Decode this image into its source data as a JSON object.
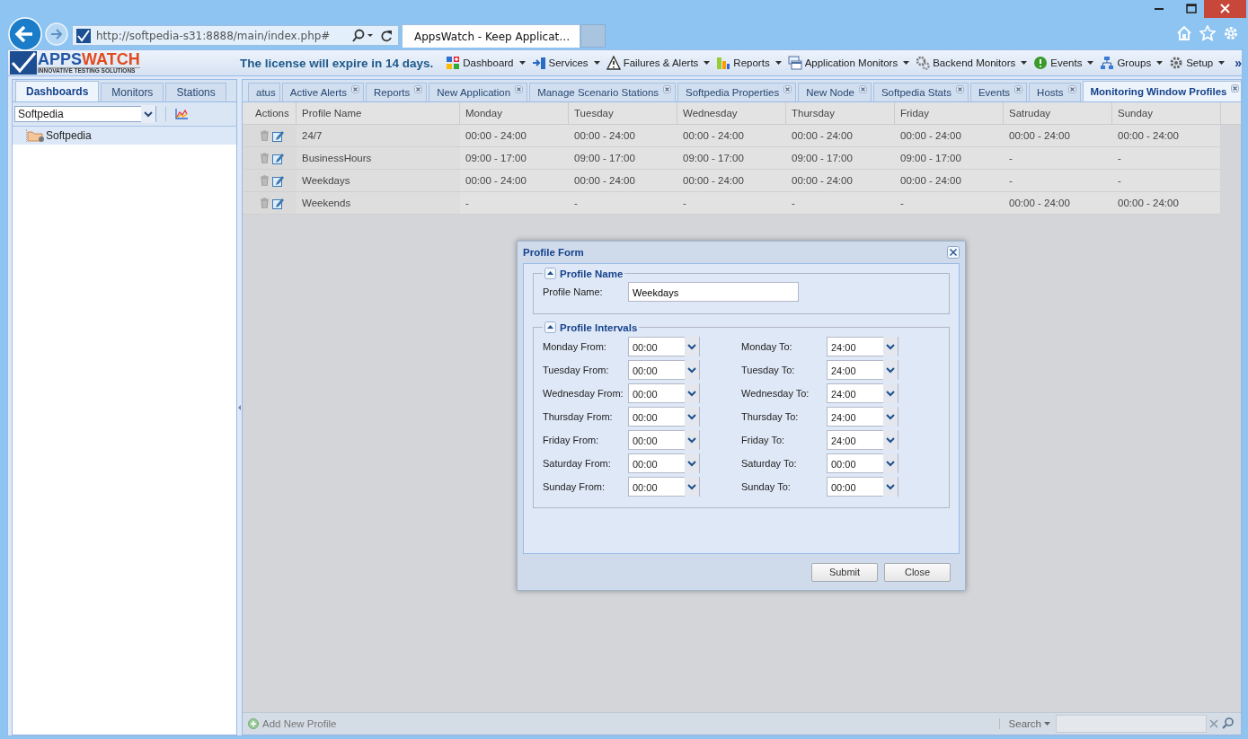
{
  "browser": {
    "url": "http://softpedia-s31:8888/main/index.php#",
    "tab_title": "AppsWatch - Keep Applicat…"
  },
  "header": {
    "logo_first": "APPS",
    "logo_second": "WATCH",
    "logo_tagline": "INNOVATIVE TESTING SOLUTIONS",
    "license": "The license will expire in 14 days.",
    "overflow": "»",
    "menu": [
      {
        "label": "Dashboard"
      },
      {
        "label": "Services"
      },
      {
        "label": "Failures & Alerts"
      },
      {
        "label": "Reports"
      },
      {
        "label": "Application Monitors"
      },
      {
        "label": "Backend Monitors"
      },
      {
        "label": "Events"
      },
      {
        "label": "Groups"
      },
      {
        "label": "Setup"
      }
    ]
  },
  "sidebar": {
    "tabs": [
      {
        "label": "Dashboards",
        "selected": true
      },
      {
        "label": "Monitors",
        "selected": false
      },
      {
        "label": "Stations",
        "selected": false
      }
    ],
    "combo": "Softpedia",
    "tree": [
      {
        "label": "Softpedia",
        "selected": true
      }
    ]
  },
  "main": {
    "tabs": [
      {
        "label": "atus",
        "selected": false,
        "closable": false
      },
      {
        "label": "Active Alerts",
        "selected": false,
        "closable": true
      },
      {
        "label": "Reports",
        "selected": false,
        "closable": true
      },
      {
        "label": "New Application",
        "selected": false,
        "closable": true
      },
      {
        "label": "Manage Scenario Stations",
        "selected": false,
        "closable": true
      },
      {
        "label": "Softpedia Properties",
        "selected": false,
        "closable": true
      },
      {
        "label": "New Node",
        "selected": false,
        "closable": true
      },
      {
        "label": "Softpedia Stats",
        "selected": false,
        "closable": true
      },
      {
        "label": "Events",
        "selected": false,
        "closable": true
      },
      {
        "label": "Hosts",
        "selected": false,
        "closable": true
      },
      {
        "label": "Monitoring Window Profiles",
        "selected": true,
        "closable": true
      }
    ],
    "table": {
      "columns": [
        "Actions",
        "Profile Name",
        "Monday",
        "Tuesday",
        "Wednesday",
        "Thursday",
        "Friday",
        "Satruday",
        "Sunday"
      ],
      "rows": [
        {
          "cells": [
            "",
            "24/7",
            "00:00 - 24:00",
            "00:00 - 24:00",
            "00:00 - 24:00",
            "00:00 - 24:00",
            "00:00 - 24:00",
            "00:00 - 24:00",
            "00:00 - 24:00"
          ]
        },
        {
          "cells": [
            "",
            "BusinessHours",
            "09:00 - 17:00",
            "09:00 - 17:00",
            "09:00 - 17:00",
            "09:00 - 17:00",
            "09:00 - 17:00",
            "-",
            "-"
          ]
        },
        {
          "cells": [
            "",
            "Weekdays",
            "00:00 - 24:00",
            "00:00 - 24:00",
            "00:00 - 24:00",
            "00:00 - 24:00",
            "00:00 - 24:00",
            "-",
            "-"
          ]
        },
        {
          "cells": [
            "",
            "Weekends",
            "-",
            "-",
            "-",
            "-",
            "-",
            "00:00 - 24:00",
            "00:00 - 24:00"
          ]
        }
      ]
    },
    "footer": {
      "add_button": "Add New Profile",
      "search_label": "Search"
    }
  },
  "dialog": {
    "title": "Profile Form",
    "name_section": {
      "title": "Profile Name",
      "label": "Profile Name:",
      "value": "Weekdays"
    },
    "intervals_section": {
      "title": "Profile Intervals",
      "rows": [
        {
          "from_label": "Monday From:",
          "from_value": "00:00",
          "to_label": "Monday To:",
          "to_value": "24:00"
        },
        {
          "from_label": "Tuesday From:",
          "from_value": "00:00",
          "to_label": "Tuesday To:",
          "to_value": "24:00"
        },
        {
          "from_label": "Wednesday From:",
          "from_value": "00:00",
          "to_label": "Wednesday To:",
          "to_value": "24:00"
        },
        {
          "from_label": "Thursday From:",
          "from_value": "00:00",
          "to_label": "Thursday To:",
          "to_value": "24:00"
        },
        {
          "from_label": "Friday From:",
          "from_value": "00:00",
          "to_label": "Friday To:",
          "to_value": "24:00"
        },
        {
          "from_label": "Saturday From:",
          "from_value": "00:00",
          "to_label": "Saturday To:",
          "to_value": "00:00"
        },
        {
          "from_label": "Sunday From:",
          "from_value": "00:00",
          "to_label": "Sunday To:",
          "to_value": "00:00"
        }
      ]
    },
    "buttons": [
      "Submit",
      "Close"
    ]
  }
}
